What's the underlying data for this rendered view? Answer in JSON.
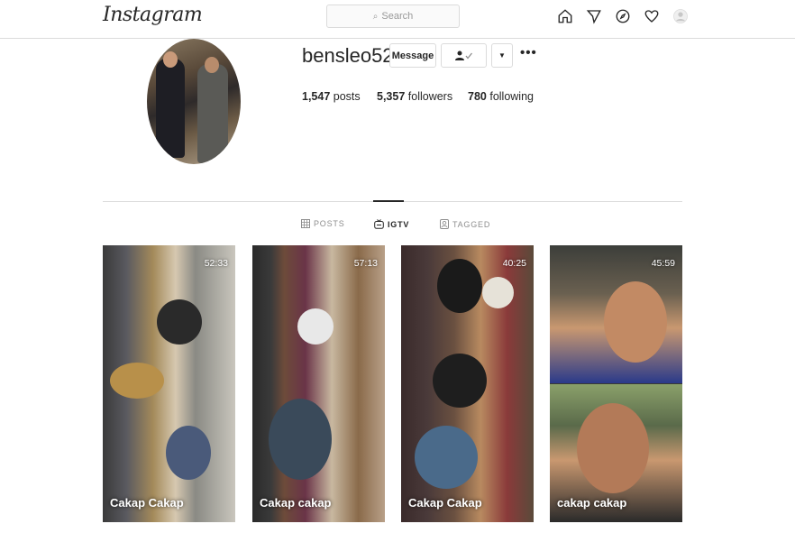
{
  "header": {
    "logo": "Instagram",
    "search_placeholder": "Search",
    "nav_icons": [
      "home-icon",
      "direct-icon",
      "explore-icon",
      "activity-heart-icon",
      "profile-avatar-icon"
    ]
  },
  "profile": {
    "username": "bensleo52",
    "message_label": "Message",
    "stats": {
      "posts_count": "1,547",
      "posts_label": "posts",
      "followers_count": "5,357",
      "followers_label": "followers",
      "following_count": "780",
      "following_label": "following"
    }
  },
  "tabs": [
    {
      "label": "POSTS",
      "icon": "grid-icon",
      "active": false
    },
    {
      "label": "IGTV",
      "icon": "igtv-icon",
      "active": true
    },
    {
      "label": "TAGGED",
      "icon": "tagged-icon",
      "active": false
    }
  ],
  "videos": [
    {
      "duration": "52:33",
      "title": "Cakap Cakap"
    },
    {
      "duration": "57:13",
      "title": "Cakap cakap"
    },
    {
      "duration": "40:25",
      "title": "Cakap Cakap"
    },
    {
      "duration": "45:59",
      "title": "cakap cakap"
    }
  ],
  "colors": {
    "border": "#dbdbdb",
    "text": "#262626",
    "muted": "#8e8e8e"
  }
}
